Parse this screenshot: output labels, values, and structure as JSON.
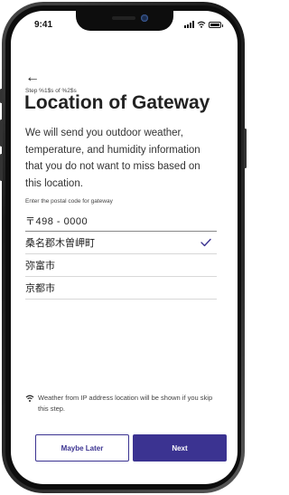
{
  "status_bar": {
    "time": "9:41"
  },
  "header": {
    "step_text": "Step %1$s of %2$s",
    "title": "Location of Gateway"
  },
  "description": "We will send you outdoor weather, temperature, and humidity information that you do not want to miss based on this location.",
  "postal": {
    "label": "Enter the postal code for gateway",
    "value": "〒498 - 0000"
  },
  "results": [
    {
      "label": "桑名郡木曽岬町",
      "selected": true
    },
    {
      "label": "弥富市",
      "selected": false
    },
    {
      "label": "京都市",
      "selected": false
    }
  ],
  "notice": {
    "icon": "wifi-icon",
    "text": "Weather from IP address location will be shown if you skip this step."
  },
  "buttons": {
    "maybe_later": "Maybe Later",
    "next": "Next"
  },
  "colors": {
    "primary": "#3b3391",
    "text": "#222222"
  }
}
